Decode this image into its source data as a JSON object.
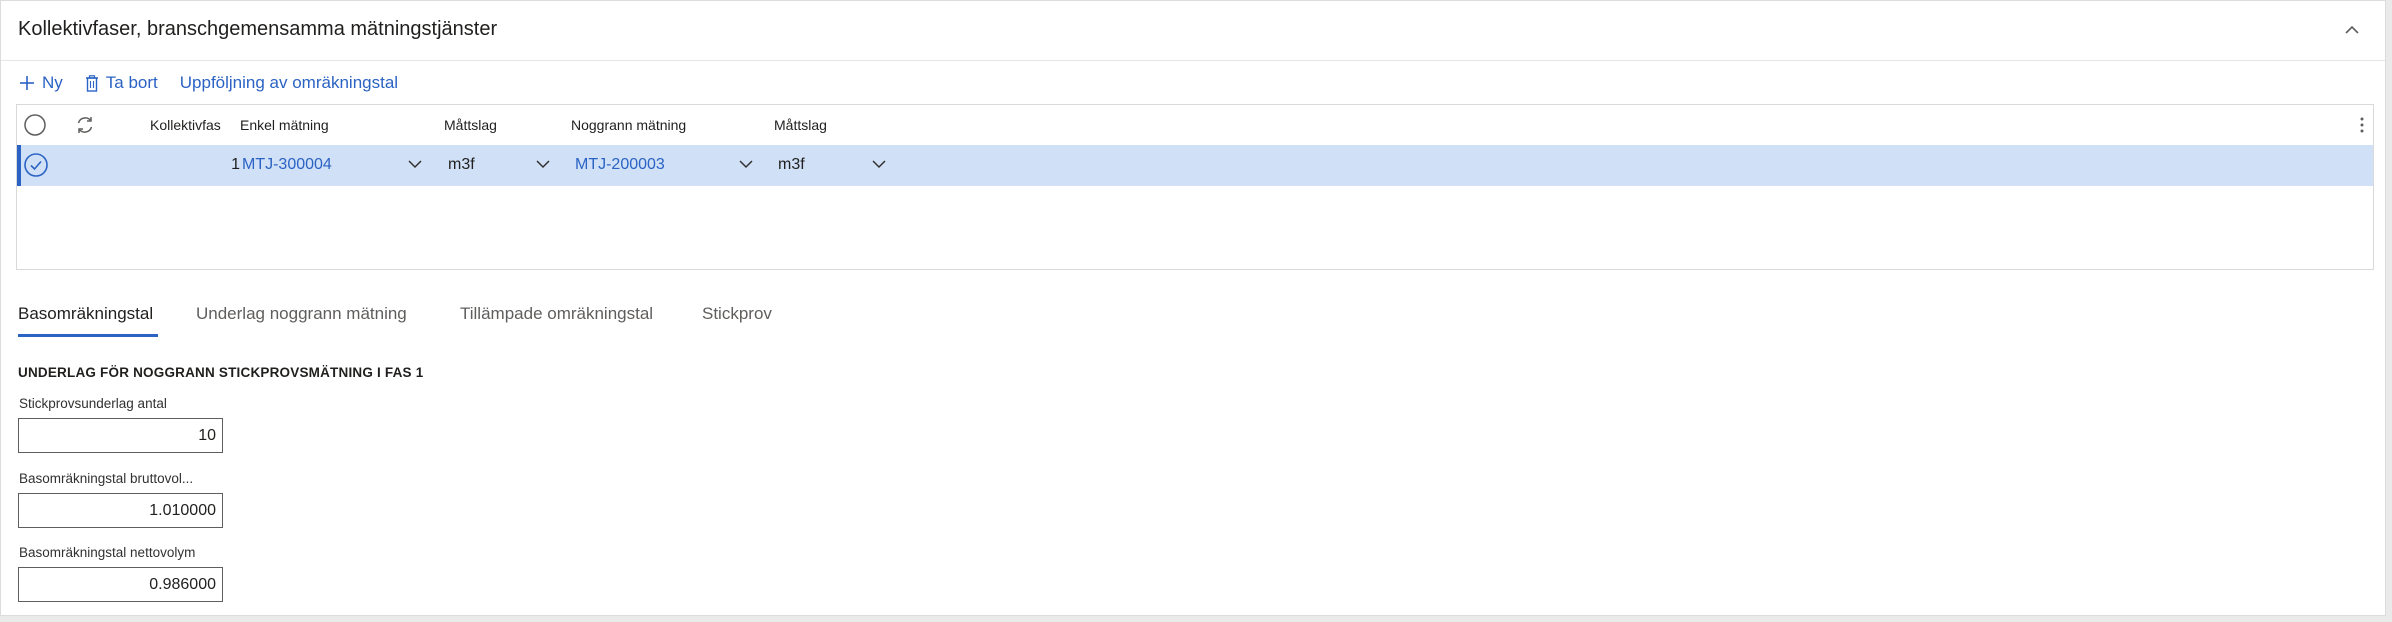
{
  "panel": {
    "title": "Kollektivfaser, branschgemensamma mätningstjänster"
  },
  "toolbar": {
    "new_label": "Ny",
    "delete_label": "Ta bort",
    "followup_label": "Uppföljning av omräkningstal"
  },
  "grid": {
    "columns": [
      "Kollektivfas",
      "Enkel mätning",
      "Måttslag",
      "Noggrann mätning",
      "Måttslag"
    ],
    "rows": [
      {
        "kollektivfas": "1",
        "enkel_matning": "MTJ-300004",
        "mattslag1": "m3f",
        "noggrann_matning": "MTJ-200003",
        "mattslag2": "m3f"
      }
    ]
  },
  "tabs": [
    {
      "label": "Basomräkningstal",
      "active": true
    },
    {
      "label": "Underlag noggrann mätning",
      "active": false
    },
    {
      "label": "Tillämpade omräkningstal",
      "active": false
    },
    {
      "label": "Stickprov",
      "active": false
    }
  ],
  "section": {
    "title": "UNDERLAG FÖR NOGGRANN STICKPROVSMÄTNING I FAS 1",
    "fields": [
      {
        "label": "Stickprovsunderlag antal",
        "value": "10"
      },
      {
        "label": "Basomräkningstal bruttovol...",
        "value": "1.010000"
      },
      {
        "label": "Basomräkningstal nettovolym",
        "value": "0.986000"
      }
    ]
  },
  "colors": {
    "accent": "#2b63c4",
    "selected_row": "#cfe0f7"
  }
}
